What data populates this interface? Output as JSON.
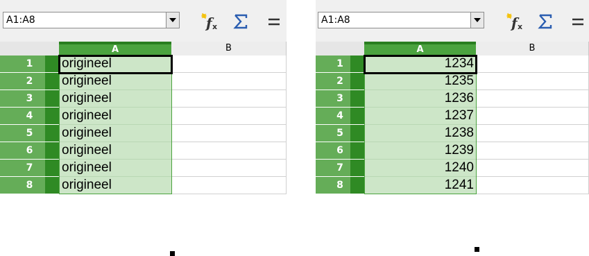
{
  "left": {
    "name_box": "A1:A8",
    "columns": [
      "A",
      "B"
    ],
    "rows": [
      "1",
      "2",
      "3",
      "4",
      "5",
      "6",
      "7",
      "8"
    ],
    "cells_a": [
      "origineel",
      "origineel",
      "origineel",
      "origineel",
      "origineel",
      "origineel",
      "origineel",
      "origineel"
    ]
  },
  "right": {
    "name_box": "A1:A8",
    "columns": [
      "A",
      "B"
    ],
    "rows": [
      "1",
      "2",
      "3",
      "4",
      "5",
      "6",
      "7",
      "8"
    ],
    "cells_a": [
      "1234",
      "1235",
      "1236",
      "1237",
      "1238",
      "1239",
      "1240",
      "1241"
    ]
  },
  "icons": [
    "function-wizard-icon",
    "sum-icon",
    "equals-icon"
  ],
  "colors": {
    "selected_header": "#4ba33f",
    "row_header_dark": "#2f8a24",
    "row_header_light": "#65ad58",
    "selected_cell": "#cde6c8"
  }
}
